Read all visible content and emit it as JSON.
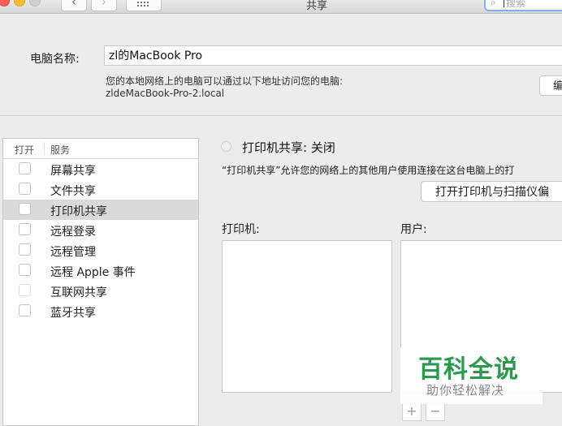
{
  "window": {
    "title": "共享"
  },
  "toolbar": {
    "back": "‹",
    "forward": "›",
    "search_placeholder": "搜索"
  },
  "computer": {
    "name_label": "电脑名称:",
    "name_value": "zl的MacBook Pro",
    "address_note": "您的本地网络上的电脑可以通过以下地址访问您的电脑:",
    "address": "zldeMacBook-Pro-2.local",
    "edit_button": "编"
  },
  "services": {
    "header_open": "打开",
    "header_service": "服务",
    "items": [
      {
        "label": "屏幕共享",
        "checked": false,
        "selected": false
      },
      {
        "label": "文件共享",
        "checked": false,
        "selected": false
      },
      {
        "label": "打印机共享",
        "checked": false,
        "selected": true
      },
      {
        "label": "远程登录",
        "checked": false,
        "selected": false
      },
      {
        "label": "远程管理",
        "checked": false,
        "selected": false
      },
      {
        "label": "远程 Apple 事件",
        "checked": false,
        "selected": false
      },
      {
        "label": "互联网共享",
        "checked": false,
        "selected": false
      },
      {
        "label": "蓝牙共享",
        "checked": false,
        "selected": false
      }
    ]
  },
  "detail": {
    "status": "打印机共享: 关闭",
    "description": "“打印机共享”允许您的网络上的其他用户使用连接在这台电脑上的打",
    "open_prefs_button": "打开打印机与扫描仪偏",
    "printers_label": "打印机:",
    "users_label": "用户:",
    "add": "+",
    "remove": "−"
  },
  "watermark": {
    "title": "百科全说",
    "subtitle": "助你轻松解决"
  },
  "colors": {
    "selection": "#dadada",
    "watermark_green": "#2c9a4e",
    "search_focus": "#7fb2ef"
  }
}
